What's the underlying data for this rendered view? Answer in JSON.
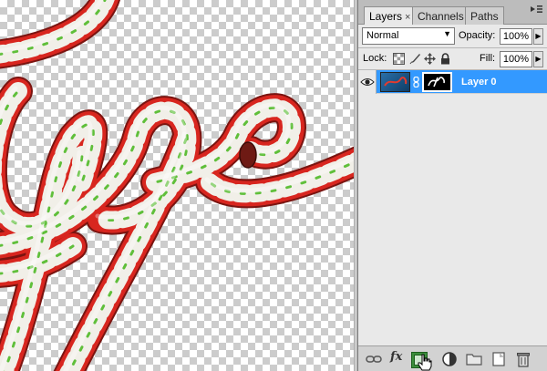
{
  "panel": {
    "tabs": [
      {
        "label": "Layers",
        "close": "×",
        "active": true
      },
      {
        "label": "Channels",
        "active": false
      },
      {
        "label": "Paths",
        "active": false
      }
    ],
    "menu_icon": "panel-menu-icon"
  },
  "blend": {
    "mode": "Normal",
    "opacity_label": "Opacity:",
    "opacity_value": "100%"
  },
  "lock": {
    "label": "Lock:",
    "fill_label": "Fill:",
    "fill_value": "100%",
    "icons": [
      "lock-transparent-pixels-icon",
      "lock-image-pixels-icon",
      "lock-position-icon",
      "lock-all-icon"
    ]
  },
  "layers": [
    {
      "name": "Layer 0",
      "visible": true,
      "selected": true,
      "has_mask": true
    }
  ],
  "bottom_icons": [
    "link-layers-icon",
    "fx-icon",
    "add-layer-mask-icon",
    "adjustment-layer-icon",
    "new-group-icon",
    "new-layer-icon",
    "delete-layer-icon"
  ],
  "colors": {
    "selection": "#3399ff",
    "candy_red": "#dd2a22",
    "candy_green": "#5fbf3a"
  },
  "fx_text": "fx"
}
